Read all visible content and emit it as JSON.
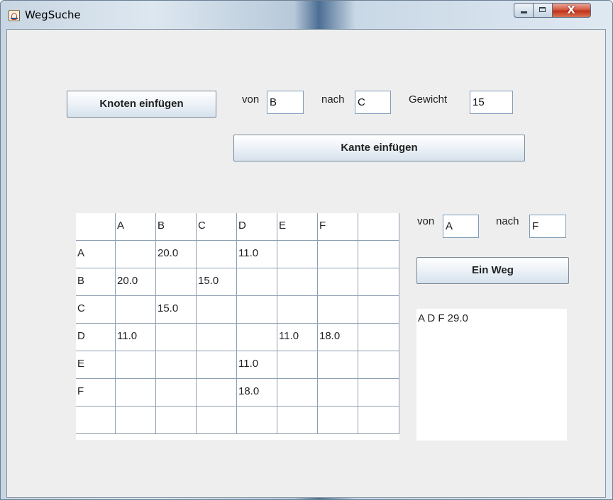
{
  "window": {
    "title": "WegSuche",
    "close_glyph": "X",
    "icons": {
      "app": "java-cup-icon",
      "minimize": "minimize-icon",
      "maximize": "maximize-icon",
      "close": "close-icon"
    }
  },
  "node_section": {
    "insert_node_button": "Knoten einfügen",
    "from_label": "von",
    "from_value": "B",
    "to_label": "nach",
    "to_value": "C",
    "weight_label": "Gewicht",
    "weight_value": "15",
    "insert_edge_button": "Kante einfügen"
  },
  "matrix": {
    "headers": [
      "",
      "A",
      "B",
      "C",
      "D",
      "E",
      "F",
      ""
    ],
    "rows": [
      [
        "A",
        "",
        "20.0",
        "",
        "11.0",
        "",
        "",
        ""
      ],
      [
        "B",
        "20.0",
        "",
        "15.0",
        "",
        "",
        "",
        ""
      ],
      [
        "C",
        "",
        "15.0",
        "",
        "",
        "",
        "",
        ""
      ],
      [
        "D",
        "11.0",
        "",
        "",
        "",
        "11.0",
        "18.0",
        ""
      ],
      [
        "E",
        "",
        "",
        "",
        "11.0",
        "",
        "",
        ""
      ],
      [
        "F",
        "",
        "",
        "",
        "18.0",
        "",
        "",
        ""
      ],
      [
        "",
        "",
        "",
        "",
        "",
        "",
        "",
        ""
      ]
    ]
  },
  "path_section": {
    "from_label": "von",
    "from_value": "A",
    "to_label": "nach",
    "to_value": "F",
    "find_path_button": "Ein Weg",
    "result": "A D F 29.0"
  }
}
